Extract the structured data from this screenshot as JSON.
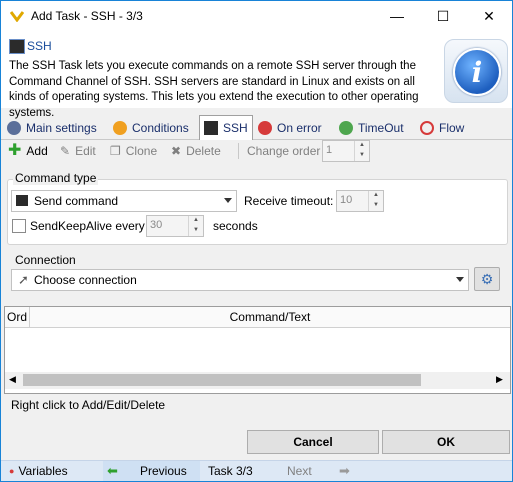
{
  "window": {
    "title": "Add Task - SSH - 3/3",
    "minimize": "—",
    "maximize": "☐",
    "close": "✕"
  },
  "header": {
    "title": "SSH",
    "description": "The SSH Task lets you execute commands on a remote SSH server through the Command Channel of SSH. SSH servers are standard in Linux and exists on all kinds of operating systems. This lets you extend the execution to other operating systems."
  },
  "tabs": [
    {
      "label": "Main settings",
      "icon": "gear-icon"
    },
    {
      "label": "Conditions",
      "icon": "question-icon"
    },
    {
      "label": "SSH",
      "icon": "terminal-icon"
    },
    {
      "label": "On error",
      "icon": "error-icon"
    },
    {
      "label": "TimeOut",
      "icon": "timeout-icon"
    },
    {
      "label": "Flow",
      "icon": "flow-icon"
    }
  ],
  "toolbar": {
    "add": "Add",
    "edit": "Edit",
    "clone": "Clone",
    "delete": "Delete",
    "change_order": "Change order",
    "order_value": "1"
  },
  "command_type": {
    "group_label": "Command type",
    "selected": "Send command",
    "receive_timeout_label": "Receive timeout:",
    "receive_timeout_value": "10",
    "keepalive_label": "SendKeepAlive every",
    "keepalive_value": "30",
    "seconds_label": "seconds"
  },
  "connection": {
    "group_label": "Connection",
    "placeholder": "Choose connection"
  },
  "grid": {
    "columns": [
      "Ord",
      "Command/Text"
    ]
  },
  "hint": "Right click to Add/Edit/Delete",
  "buttons": {
    "cancel": "Cancel",
    "ok": "OK"
  },
  "statusbar": {
    "variables": "Variables",
    "previous": "Previous",
    "task": "Task 3/3",
    "next": "Next"
  },
  "colors": {
    "accent": "#1883d7",
    "tab_text": "#1a2f6b",
    "status_bg": "#dde8f5"
  }
}
